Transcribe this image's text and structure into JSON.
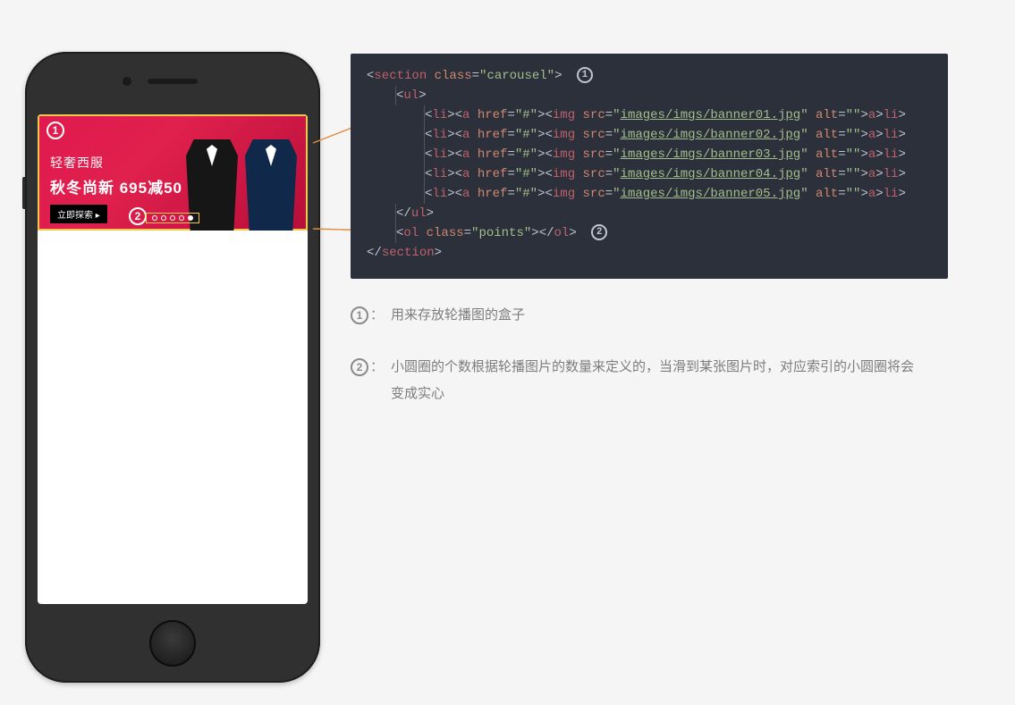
{
  "banner": {
    "line1": "轻奢西服",
    "line2": "秋冬尚新 695减50",
    "cta": "立即探索"
  },
  "markers": {
    "one": "1",
    "two": "2"
  },
  "code": {
    "l1_open": "<",
    "l1_tag": "section",
    "l1_sp": " ",
    "l1_attr": "class",
    "l1_eq": "=",
    "l1_q": "\"",
    "l1_val": "carousel",
    "l1_close": ">",
    "l2_open": "<",
    "l2_tag": "ul",
    "l2_close": ">",
    "li_open": "<",
    "li_tag": "li",
    "li_close": ">",
    "a_open": "<",
    "a_tag": "a",
    "a_sp": " ",
    "a_attr": "href",
    "a_eq": "=",
    "a_q": "\"",
    "a_val": "#",
    "a_close": ">",
    "img_open": "<",
    "img_tag": "img",
    "img_sp": " ",
    "img_attr1": "src",
    "img_attr2": "alt",
    "img_eq": "=",
    "img_q": "\"",
    "img_empty": "",
    "img_close": ">",
    "srcs": [
      "images/imgs/banner01.jpg",
      "images/imgs/banner02.jpg",
      "images/imgs/banner03.jpg",
      "images/imgs/banner04.jpg",
      "images/imgs/banner05.jpg"
    ],
    "ac_open": "</",
    "ac_tag": "a",
    "ac_close": ">",
    "lic_open": "</",
    "lic_tag": "li",
    "lic_close": ">",
    "ulc_open": "</",
    "ulc_tag": "ul",
    "ulc_close": ">",
    "ol_open": "<",
    "ol_tag": "ol",
    "ol_sp": " ",
    "ol_attr": "class",
    "ol_val": "points",
    "ol_close": ">",
    "olc_open": "</",
    "olc_tag": "ol",
    "olc_close": ">",
    "sc_open": "</",
    "sc_tag": "section",
    "sc_close": ">"
  },
  "explain": {
    "e1": "用来存放轮播图的盒子",
    "e2": "小圆圈的个数根据轮播图片的数量来定义的，当滑到某张图片时，对应索引的小圆圈将会变成实心"
  }
}
